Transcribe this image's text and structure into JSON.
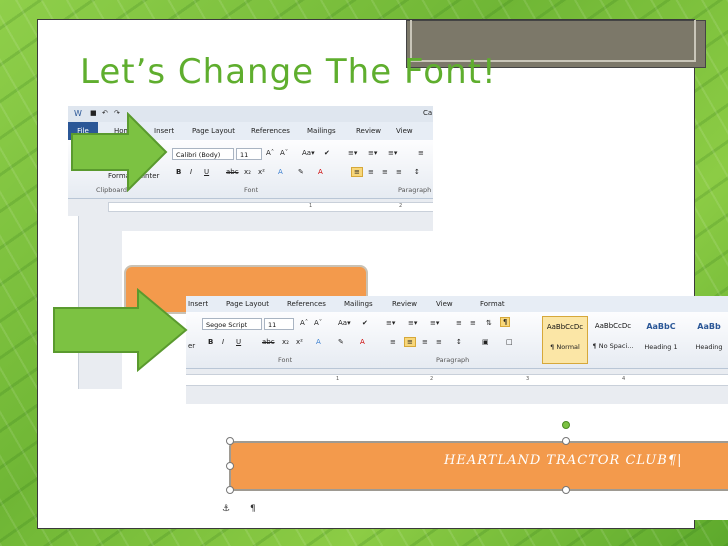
{
  "slide": {
    "title": "Let’s Change The Font!"
  },
  "shot1": {
    "file_tab": "File",
    "tabs": [
      "Home",
      "Insert",
      "Page Layout",
      "References",
      "Mailings",
      "Review",
      "View"
    ],
    "font_name": "Calibri (Body)",
    "font_size": "11",
    "clipboard_label": "Clipboard",
    "format_painter": "Format Painter",
    "group_font": "Font",
    "group_paragraph": "Paragraph",
    "title_fragment": "Ca"
  },
  "shot2": {
    "tabs": [
      "Insert",
      "Page Layout",
      "References",
      "Mailings",
      "Review",
      "View",
      "Format"
    ],
    "font_name": "Segoe Script",
    "font_size": "11",
    "group_font": "Font",
    "group_paragraph": "Paragraph",
    "left_fragment": "er",
    "styles": [
      {
        "preview": "AaBbCcDc",
        "name": "¶ Normal"
      },
      {
        "preview": "AaBbCcDc",
        "name": "¶ No Spaci..."
      },
      {
        "preview": "AaBbC",
        "name": "Heading 1"
      },
      {
        "preview": "AaBb",
        "name": "Heading"
      }
    ],
    "ruler_numbers": [
      "1",
      "2",
      "3",
      "4"
    ],
    "shape_text": "HEARTLAND TRACTOR CLUB¶|"
  },
  "colors": {
    "title": "#5fae2e",
    "orange": "#f39a4c",
    "green_arrow": "#7cc242",
    "file_tab": "#2b5797"
  }
}
